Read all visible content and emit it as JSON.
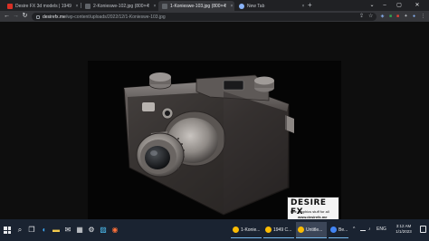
{
  "browser": {
    "tabs": [
      {
        "title": "Desire FX 3d models | 1949 Canon...",
        "favicon_color": "#d93025",
        "active": false
      },
      {
        "title": "2-Konieswe-102.jpg (800×450)",
        "favicon_color": "#5f6368",
        "active": false
      },
      {
        "title": "1-Konieswe-103.jpg (800×450)",
        "favicon_color": "#5f6368",
        "active": true
      },
      {
        "title": "New Tab",
        "favicon_color": "#8ab4f8",
        "active": false
      }
    ],
    "new_tab_symbol": "+",
    "window_controls": {
      "dropdown": "⌄",
      "minimize": "–",
      "maximize": "▢",
      "close": "✕"
    },
    "tab_close": "×",
    "nav": {
      "back": "←",
      "forward": "→",
      "reload": "↻"
    },
    "url_host": "desirefx.me",
    "url_path": "/wp-content/uploads/2022/12/1-Konieswe-103.jpg",
    "omnibox_icons": {
      "share": "⇪",
      "star": "☆"
    },
    "extensions": [
      {
        "name": "shield-extension-icon",
        "color": "#8ab4f8",
        "glyph": "◈"
      },
      {
        "name": "green-extension-icon",
        "color": "#34a853",
        "glyph": "■"
      },
      {
        "name": "red-extension-icon",
        "color": "#ea4335",
        "glyph": "■"
      },
      {
        "name": "puzzle-extension-icon",
        "color": "#5f6368",
        "glyph": "✦"
      },
      {
        "name": "profile-icon",
        "color": "#1a73e8",
        "glyph": "●"
      },
      {
        "name": "menu-icon",
        "color": "#35363a",
        "glyph": "⋮"
      }
    ]
  },
  "image": {
    "watermark_brand": "DESIRE FX",
    "watermark_line1": "free graphics stuff for all",
    "watermark_line2": "www.desirefx.me"
  },
  "taskbar": {
    "icons": [
      {
        "name": "search-icon",
        "glyph": "⌕"
      },
      {
        "name": "task-view-icon",
        "glyph": "❐"
      },
      {
        "name": "edge-icon",
        "glyph": "◐"
      },
      {
        "name": "file-explorer-icon",
        "glyph": "▬"
      },
      {
        "name": "mail-icon",
        "glyph": "✉"
      },
      {
        "name": "store-icon",
        "glyph": "▦"
      },
      {
        "name": "settings-icon",
        "glyph": "⚙"
      },
      {
        "name": "photos-icon",
        "glyph": "▨"
      },
      {
        "name": "firefox-icon",
        "glyph": "◉"
      }
    ],
    "apps": [
      {
        "label": "1-Konie...",
        "icon_color": "#fbbc04",
        "active": false
      },
      {
        "label": "1949 C...",
        "icon_color": "#fbbc04",
        "active": false
      },
      {
        "label": "Untitle...",
        "icon_color": "#fbbc04",
        "active": true
      },
      {
        "label": "Be...",
        "icon_color": "#4285f4",
        "active": false
      }
    ],
    "tray": {
      "chevron": "^",
      "lang": "ENG"
    },
    "time": "3:12 AM",
    "date": "1/1/2023"
  },
  "colors": {
    "accent": "#8ab4f8",
    "tab_strip": "#202124",
    "toolbar": "#35363a",
    "taskbar": "#1a2331"
  }
}
